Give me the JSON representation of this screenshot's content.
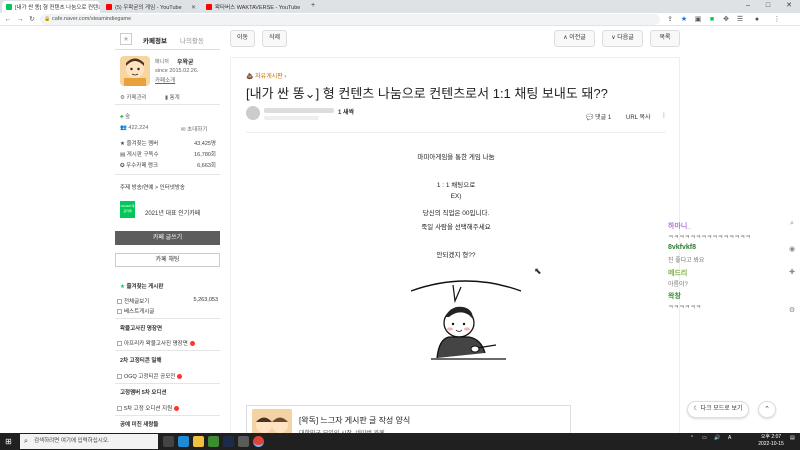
{
  "browser": {
    "tabs": [
      {
        "label": "[내가 싼 똥] 형 컨텐츠 나눔으로 컨텐츠로서",
        "fav_color": "#03c75a",
        "active": true
      },
      {
        "label": "(5) 우왁굳의 게임 - YouTube",
        "fav_color": "#ff0000",
        "active": false
      },
      {
        "label": "왁타버스 WAKTAVERSE - YouTube",
        "fav_color": "#ff0000",
        "active": false
      }
    ],
    "new_tab": "+",
    "url": "cafe.naver.com/steamindiegame",
    "win_min": "–",
    "win_max": "□",
    "win_close": "✕"
  },
  "sidebar": {
    "tab_cafe_info": "카페정보",
    "tab_my_activity": "나의활동",
    "manager_label": "매니저",
    "manager_name": "우왁굳",
    "since": "since 2015.02.26.",
    "cafe_intro": "카페소개",
    "cafe_manage": "카페관리",
    "stats": "통계",
    "level": "숲",
    "members": "422,224",
    "invite": "초대하기",
    "rows": [
      {
        "label": "즐겨찾는 멤버",
        "value": "43,425명"
      },
      {
        "label": "게시판 구독수",
        "value": "16,780회"
      },
      {
        "label": "우수카페 랭크",
        "value": "6,663회"
      }
    ],
    "topics": "주제  방송/연예 > 인터넷방송",
    "award_text": "2021년 대표 인기카페",
    "badge_text": "NAVER 대표카페",
    "write_btn": "카페 글쓰기",
    "chat_btn": "카페 채팅",
    "menu": [
      {
        "label": "즐겨찾는 게시판",
        "type": "head"
      },
      {
        "label": "전체글보기",
        "value": "5,263,053",
        "type": "check"
      },
      {
        "label": "베스트게시글",
        "type": "check"
      },
      {
        "label": "왁물고사진 명장면",
        "type": "head"
      },
      {
        "label": "아프리카 왁물고사진 명장면",
        "type": "check-red"
      },
      {
        "label": "2차 고정티콘 일해",
        "type": "head"
      },
      {
        "label": "OGQ 고정티콘 공모전",
        "type": "check-red"
      },
      {
        "label": "고정멤버 5차 오디션",
        "type": "head"
      },
      {
        "label": "5차 고정 오디션 지원",
        "type": "check-red"
      },
      {
        "label": "공예 미친 새랑들",
        "type": "head"
      }
    ]
  },
  "toolbar": {
    "move": "이동",
    "delete": "삭제",
    "prev": "∧ 이전글",
    "next": "∨ 다음글",
    "list": "목록"
  },
  "article": {
    "board": "자유게시판 ›",
    "title": "[내가 싼 똥⌄] 형 컨텐츠 나눔으로 컨텐츠로서 1:1 채팅 보내도 돼??",
    "rank": "1 새싹",
    "comments": "댓글 1",
    "url_copy": "URL 복사",
    "more": "⋮",
    "body": [
      "마피아게임을 통한 게임 나눔",
      "",
      "1 : 1 채팅으로",
      "EX)",
      "당신의 직업은 00입니다.",
      "죽일 사람을 선택해주세요",
      "",
      "안되겠지 형??"
    ],
    "related_title": "[왁독] 느그자 게시판 글 작성 양식",
    "related_sub": "대한민국 모임의 시작, 네이버 카페"
  },
  "chat": [
    {
      "nick": "하마니_",
      "color": "#b07cd8",
      "msg": "ㅋㅋㅋㅋㅋㅋㅋㅋㅋㅋㅋㅋㅋㅋㅋ"
    },
    {
      "nick": "8vkfvkf8",
      "color": "#2e7d32",
      "msg": "진 좋다고 봐요"
    },
    {
      "nick": "메드리",
      "color": "#7cb342",
      "msg": "아름이?"
    },
    {
      "nick": "왁창",
      "color": "#388e3c",
      "msg": "ㅋㅋㅋㅋㅋㅋ"
    }
  ],
  "floating": {
    "dark_mode": "다크 모드로 보기",
    "to_top": "⌃"
  },
  "taskbar": {
    "search_placeholder": "검색하려면 여기에 입력하십시오.",
    "time": "오후 2:07",
    "date": "2022-10-15",
    "lang": "A"
  }
}
